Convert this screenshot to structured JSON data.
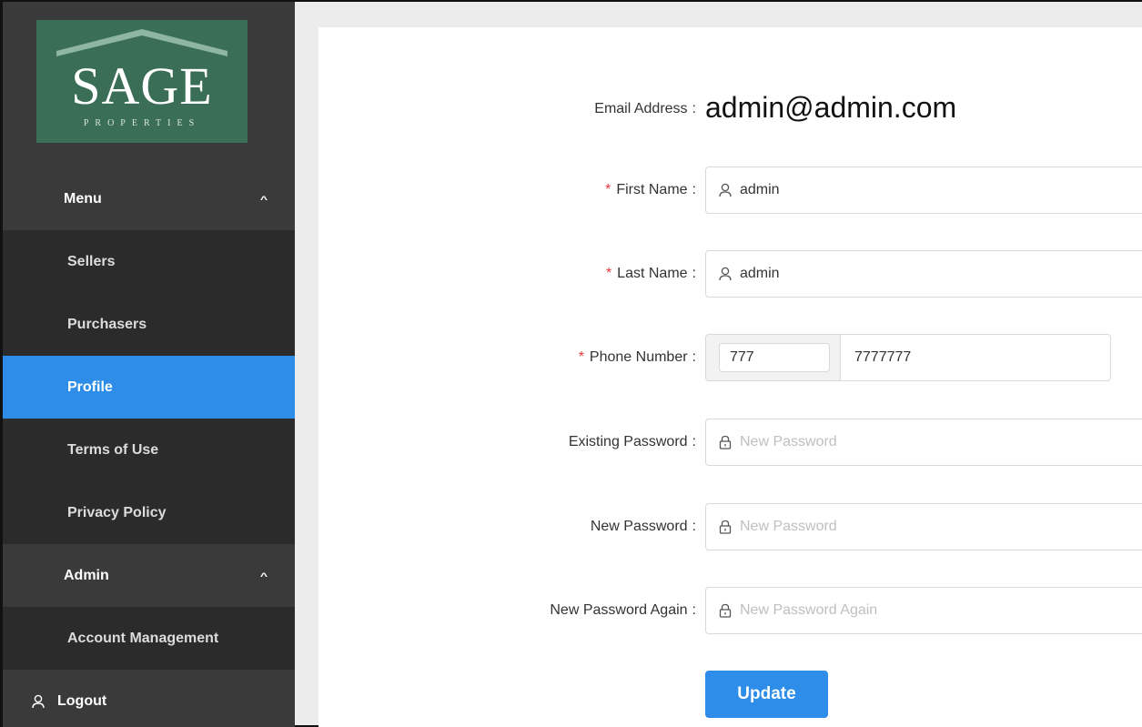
{
  "brand": {
    "name": "SAGE",
    "tagline": "PROPERTIES",
    "color": "#3b6e57"
  },
  "sidebar": {
    "menu_label": "Menu",
    "menu_items": [
      {
        "label": "Sellers"
      },
      {
        "label": "Purchasers"
      },
      {
        "label": "Profile",
        "active": true
      },
      {
        "label": "Terms of Use"
      },
      {
        "label": "Privacy Policy"
      }
    ],
    "admin_label": "Admin",
    "admin_items": [
      {
        "label": "Account Management"
      }
    ],
    "logout_label": "Logout",
    "active_color": "#2d8de8"
  },
  "form": {
    "email": {
      "label": "Email Address",
      "value": "admin@admin.com"
    },
    "first_name": {
      "label": "First Name",
      "value": "admin",
      "required": true
    },
    "last_name": {
      "label": "Last Name",
      "value": "admin",
      "required": true
    },
    "phone": {
      "label": "Phone Number",
      "code": "777",
      "number": "7777777",
      "required": true
    },
    "existing_password": {
      "label": "Existing Password",
      "placeholder": "New Password"
    },
    "new_password": {
      "label": "New Password",
      "placeholder": "New Password"
    },
    "new_password_again": {
      "label": "New Password Again",
      "placeholder": "New Password Again"
    },
    "submit_label": "Update"
  }
}
